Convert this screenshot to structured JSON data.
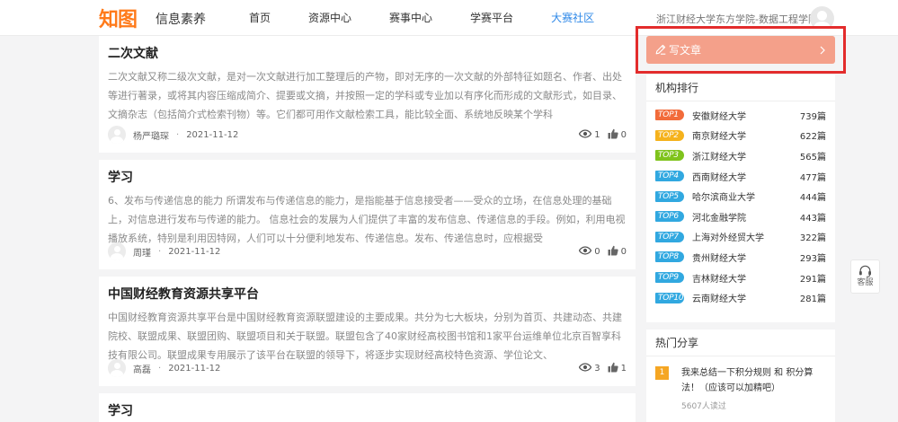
{
  "header": {
    "logo": "知图",
    "brand": "信息素养",
    "nav": [
      {
        "label": "首页"
      },
      {
        "label": "资源中心"
      },
      {
        "label": "赛事中心"
      },
      {
        "label": "学赛平台"
      },
      {
        "label": "大赛社区"
      }
    ],
    "active_nav": "大赛社区",
    "school": "浙江财经大学东方学院-数据工程学院"
  },
  "articles": [
    {
      "title": "二次文献",
      "desc": "二次文献又称二级次文献，是对一次文献进行加工整理后的产物，即对无序的一次文献的外部特征如题名、作者、出处等进行著录，或将其内容压缩成简介、提要或文摘，并按照一定的学科或专业加以有序化而形成的文献形式，如目录、文摘杂志（包括简介式检索刊物）等。它们都可用作文献检索工具，能比较全面、系统地反映某个学科",
      "author": "杨严璐琛",
      "date": "2021-11-12",
      "views": "1",
      "likes": "0"
    },
    {
      "title": "学习",
      "desc": "6、发布与传递信息的能力 所谓发布与传递信息的能力，是指能基于信息接受者——受众的立场，在信息处理的基础上，对信息进行发布与传递的能力。 信息社会的发展为人们提供了丰富的发布信息、传递信息的手段。例如，利用电视播放系统，特别是利用因特网，人们可以十分便利地发布、传递信息。发布、传递信息时，应根据受",
      "author": "周瑾",
      "date": "2021-11-12",
      "views": "0",
      "likes": "0"
    },
    {
      "title": "中国财经教育资源共享平台",
      "desc": "中国财经教育资源共享平台是中国财经教育资源联盟建设的主要成果。共分为七大板块，分别为首页、共建动态、共建院校、联盟成果、联盟团购、联盟项目和关于联盟。联盟包含了40家财经高校图书馆和1家平台运维单位北京百智享科技有限公司。联盟成果专用展示了该平台在联盟的领导下，将逐步实现财经高校特色资源、学位论文、",
      "author": "高磊",
      "date": "2021-11-12",
      "views": "3",
      "likes": "1"
    },
    {
      "title": "学习",
      "desc": "",
      "author": "",
      "date": "",
      "views": "",
      "likes": ""
    }
  ],
  "sidebar": {
    "write_label": "写文章",
    "ranking_title": "机构排行",
    "ranking": [
      {
        "badge": "TOP1",
        "name": "安徽财经大学",
        "count": "739篇",
        "color": "#f26b3a"
      },
      {
        "badge": "TOP2",
        "name": "南京财经大学",
        "count": "622篇",
        "color": "#f5b21c"
      },
      {
        "badge": "TOP3",
        "name": "浙江财经大学",
        "count": "565篇",
        "color": "#7fc31c"
      },
      {
        "badge": "TOP4",
        "name": "西南财经大学",
        "count": "477篇",
        "color": "#31a8e0"
      },
      {
        "badge": "TOP5",
        "name": "哈尔滨商业大学",
        "count": "444篇",
        "color": "#31a8e0"
      },
      {
        "badge": "TOP6",
        "name": "河北金融学院",
        "count": "443篇",
        "color": "#31a8e0"
      },
      {
        "badge": "TOP7",
        "name": "上海对外经贸大学",
        "count": "322篇",
        "color": "#31a8e0"
      },
      {
        "badge": "TOP8",
        "name": "贵州财经大学",
        "count": "293篇",
        "color": "#31a8e0"
      },
      {
        "badge": "TOP9",
        "name": "吉林财经大学",
        "count": "291篇",
        "color": "#31a8e0"
      },
      {
        "badge": "TOP10",
        "name": "云南财经大学",
        "count": "281篇",
        "color": "#31a8e0"
      }
    ],
    "share_title": "热门分享",
    "share": [
      {
        "num": "1",
        "text": "我来总结一下积分规则 和 积分算法！（应该可以加精吧）",
        "reads": "5607人读过"
      }
    ]
  },
  "service": {
    "label": "客服"
  },
  "colors": {
    "accent": "#2e88e8",
    "write_button": "#f4a08a",
    "highlight": "#e32c2c",
    "logo": "#ff7a1a"
  }
}
